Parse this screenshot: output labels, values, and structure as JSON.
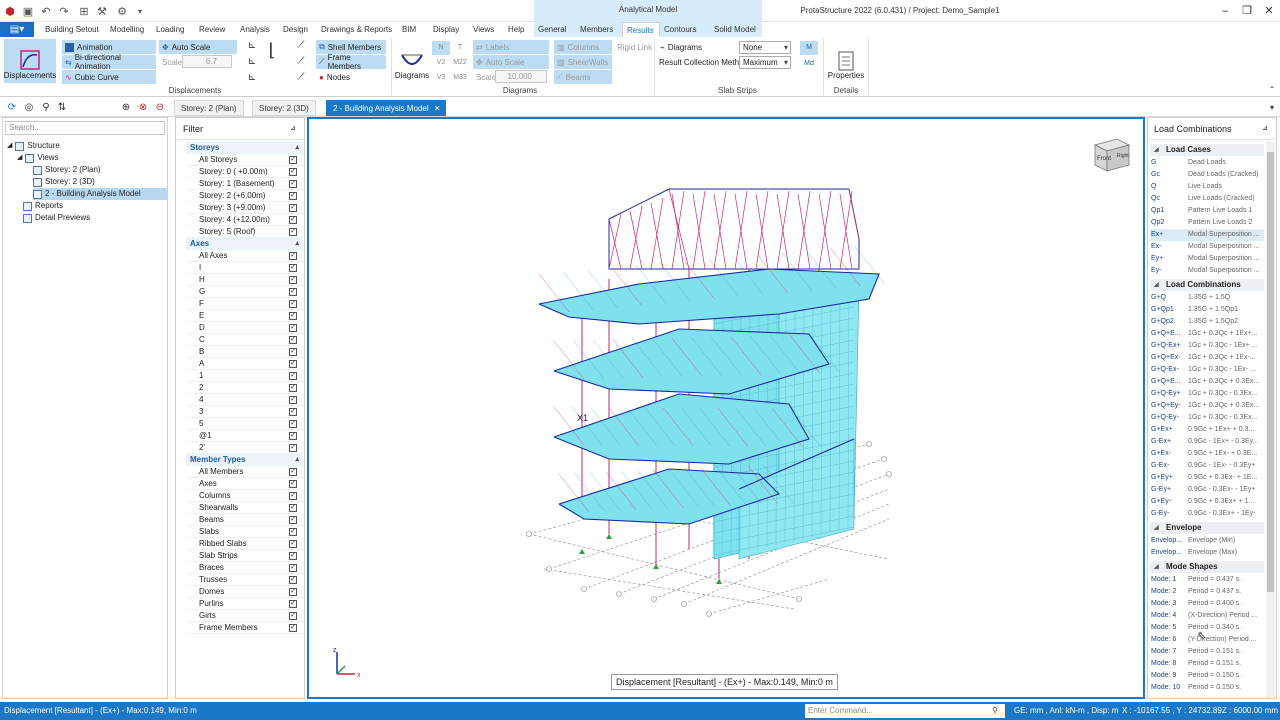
{
  "titlebar": {
    "context_tab_header": "Analytical Model",
    "app_title": "ProtaStructure 2022 (6.0.431) / Project: Demo_Sample1"
  },
  "ribbon_tabs": [
    "Building Setout",
    "Modelling",
    "Loading",
    "Review",
    "Analysis",
    "Design",
    "Drawings & Reports",
    "BIM",
    "Display",
    "Views",
    "Help",
    "General",
    "Members",
    "Results",
    "Contours",
    "Solid Model"
  ],
  "active_tab": "Results",
  "ribbon": {
    "displacements_label": "Displacements",
    "animation": "Animation",
    "bidirectional_animation": "Bi-directional Animation",
    "cubic_curve": "Cubic Curve",
    "auto_scale": "Auto Scale",
    "scale_label": "Scale",
    "scale_value": "6.7",
    "shell_members": "Shell Members",
    "frame_members": "Frame Members",
    "nodes": "Nodes",
    "group_displacements": "Displacements",
    "diagrams_label": "Diagrams",
    "force_labels": [
      "N",
      "T",
      "V2",
      "M22",
      "V3",
      "M33"
    ],
    "labels": "Labels",
    "auto_scale2": "Auto Scale",
    "scale2_label": "Scale",
    "scale2_value": "10.000",
    "columns": "Columns",
    "shearwalls": "ShearWalls",
    "beams": "Beams",
    "rigid_link": "Rigid Link",
    "group_diagrams": "Diagrams",
    "diagrams_check": "Diagrams",
    "diagrams_dropdown": "None",
    "result_collection_label": "Result Collection Method",
    "result_collection_value": "Maximum",
    "group_slab_strips": "Slab Strips",
    "m_label": "M",
    "md_label": "Md",
    "properties": "Properties",
    "group_details": "Details"
  },
  "doc_tabs": [
    "Storey: 2 (Plan)",
    "Storey: 2 (3D)",
    "2 - Building Analysis Model"
  ],
  "tree": {
    "search_placeholder": "Search...",
    "items": [
      "Structure",
      "Views",
      "Storey: 2 (Plan)",
      "Storey: 2 (3D)",
      "2 - Building Analysis Model",
      "Reports",
      "Detail Previews"
    ]
  },
  "filter": {
    "title": "Filter",
    "storeys_label": "Storeys",
    "storeys": [
      "All Storeys",
      "Storey: 0 ( +0.00m)",
      "Storey: 1 (Basement)",
      "Storey: 2 (+6.00m)",
      "Storey: 3 (+9.00m)",
      "Storey: 4 (+12.00m)",
      "Storey: 5 (Roof)"
    ],
    "axes_label": "Axes",
    "axes": [
      "All Axes",
      "I",
      "H",
      "G",
      "F",
      "E",
      "D",
      "C",
      "B",
      "A",
      "1",
      "2",
      "4",
      "3",
      "5",
      "@1",
      "2'"
    ],
    "member_types_label": "Member Types",
    "member_types": [
      "All Members",
      "Axes",
      "Columns",
      "Shearwalls",
      "Beams",
      "Slabs",
      "Ribbed Slabs",
      "Slab Strips",
      "Braces",
      "Trusses",
      "Domes",
      "Purlins",
      "Girts",
      "Frame Members"
    ]
  },
  "viewport": {
    "displacement_label": "Displacement [Resultant] - (Ex+) -  Max:0.149, Min:0 m",
    "viewcube_front": "Front",
    "viewcube_right": "Right",
    "axis_label": "X1",
    "triad_x": "x",
    "triad_z": "z"
  },
  "load_combos": {
    "title": "Load Combinations",
    "load_cases_label": "Load Cases",
    "load_cases": [
      {
        "name": "G",
        "desc": "Dead Loads"
      },
      {
        "name": "Gc",
        "desc": "Dead Loads (Cracked)"
      },
      {
        "name": "Q",
        "desc": "Live Loads"
      },
      {
        "name": "Qc",
        "desc": "Live Loads (Cracked)"
      },
      {
        "name": "Qp1",
        "desc": "Pattern Live Loads 1"
      },
      {
        "name": "Qp2",
        "desc": "Pattern Live Loads 2"
      },
      {
        "name": "Ex+",
        "desc": "Modal Superposition ..."
      },
      {
        "name": "Ex-",
        "desc": "Modal Superposition ..."
      },
      {
        "name": "Ey+",
        "desc": "Modal Superposition ..."
      },
      {
        "name": "Ey-",
        "desc": "Modal Superposition ..."
      }
    ],
    "combinations_label": "Load Combinations",
    "combinations": [
      {
        "name": "G+Q",
        "desc": "1.35G + 1.5Q"
      },
      {
        "name": "G+Qp1",
        "desc": "1.35G + 1.5Qp1"
      },
      {
        "name": "G+Qp2",
        "desc": "1.35G + 1.5Qp2"
      },
      {
        "name": "G+Q+E...",
        "desc": "1Gc + 0.3Qc + 1Ex+..."
      },
      {
        "name": "G+Q-Ex+",
        "desc": "1Gc + 0.3Qc - 1Ex+ ..."
      },
      {
        "name": "G+Q+Ex-",
        "desc": "1Gc + 0.3Qc + 1Ex-..."
      },
      {
        "name": "G+Q-Ex-",
        "desc": "1Gc + 0.3Qc - 1Ex- ..."
      },
      {
        "name": "G+Q+E...",
        "desc": "1Gc + 0.3Qc + 0.3Ex..."
      },
      {
        "name": "G+Q-Ey+",
        "desc": "1Gc + 0.3Qc - 0.3Ex..."
      },
      {
        "name": "G+Q+Ey-",
        "desc": "1Gc + 0.3Qc + 0.3Ex..."
      },
      {
        "name": "G+Q-Ey-",
        "desc": "1Gc + 0.3Qc - 0.3Ex..."
      },
      {
        "name": "G+Ex+",
        "desc": "0.9Gc + 1Ex+ + 0.3..."
      },
      {
        "name": "G-Ex+",
        "desc": "0.9Gc - 1Ex+ - 0.3Ey..."
      },
      {
        "name": "G+Ex-",
        "desc": "0.9Gc + 1Ex- + 0.3E..."
      },
      {
        "name": "G-Ex-",
        "desc": "0.9Gc - 1Ex- - 0.3Ey+"
      },
      {
        "name": "G+Ey+",
        "desc": "0.9Gc + 0.3Ex- + 1E..."
      },
      {
        "name": "G-Ey+",
        "desc": "0.9Gc - 0.3Ex- - 1Ey+"
      },
      {
        "name": "G+Ey-",
        "desc": "0.9Gc + 0.3Ex+ + 1..."
      },
      {
        "name": "G-Ey-",
        "desc": "0.9Gc - 0.3Ex+ - 1Ey-"
      }
    ],
    "envelope_label": "Envelope",
    "envelope": [
      {
        "name": "Envelop...",
        "desc": "Envelope (Min)"
      },
      {
        "name": "Envelop...",
        "desc": "Envelope (Max)"
      }
    ],
    "mode_shapes_label": "Mode Shapes",
    "mode_shapes": [
      {
        "name": "Mode: 1",
        "desc": "Period = 0.437 s."
      },
      {
        "name": "Mode: 2",
        "desc": "Period = 0.437 s."
      },
      {
        "name": "Mode: 3",
        "desc": "Period = 0.400 s."
      },
      {
        "name": "Mode: 4",
        "desc": "(X-Direction) Period ..."
      },
      {
        "name": "Mode: 5",
        "desc": "Period = 0.340 s."
      },
      {
        "name": "Mode: 6",
        "desc": "(Y-Direction) Period ..."
      },
      {
        "name": "Mode: 7",
        "desc": "Period = 0.151 s."
      },
      {
        "name": "Mode: 8",
        "desc": "Period = 0.151 s."
      },
      {
        "name": "Mode: 9",
        "desc": "Period = 0.150 s."
      },
      {
        "name": "Mode: 10",
        "desc": "Period = 0.150 s."
      }
    ]
  },
  "statusbar": {
    "left": "Displacement [Resultant] - (Ex+) - Max:0.149, Min:0 m",
    "command_placeholder": "Enter Command...",
    "units": "GE: mm , Anl: kN-m , Disp: m",
    "coords": "X : -10167.55 , Y : 24732.89",
    "z": "Z : 6000.00 mm"
  },
  "colors": {
    "accent": "#1b78c8",
    "slab_fill": "#7fe0ee",
    "frame_line": "#c0277a",
    "beam_line": "#1c2aa0"
  }
}
